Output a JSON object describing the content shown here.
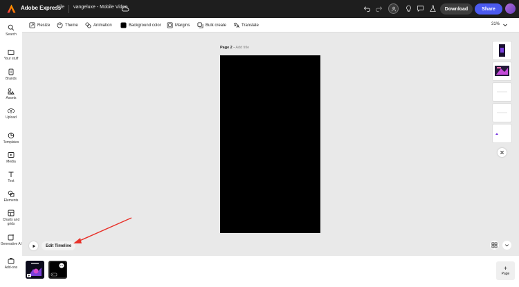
{
  "header": {
    "app_name": "Adobe Express",
    "file_menu": "File",
    "doc_title": "vangeluxe - Mobile Video",
    "download_label": "Download",
    "share_label": "Share"
  },
  "sidebar": {
    "items": [
      {
        "label": "Search",
        "icon": "search-icon"
      },
      {
        "label": "Your stuff",
        "icon": "folder-icon"
      },
      {
        "label": "Brands",
        "icon": "brand-icon"
      },
      {
        "label": "Assets",
        "icon": "assets-icon"
      },
      {
        "label": "Upload",
        "icon": "upload-icon"
      },
      {
        "label": "Templates",
        "icon": "templates-icon"
      },
      {
        "label": "Media",
        "icon": "media-icon"
      },
      {
        "label": "Text",
        "icon": "text-icon"
      },
      {
        "label": "Elements",
        "icon": "elements-icon"
      },
      {
        "label": "Charts and grids",
        "icon": "charts-icon"
      },
      {
        "label": "Generative AI",
        "icon": "generative-ai-icon"
      },
      {
        "label": "Add-ons",
        "icon": "add-ons-icon"
      }
    ]
  },
  "toolbar": {
    "resize": "Resize",
    "theme": "Theme",
    "animation": "Animation",
    "background_color": "Background color",
    "margins": "Margins",
    "bulk_create": "Bulk create",
    "translate": "Translate",
    "zoom": "31%"
  },
  "canvas": {
    "page_label": "Page 2",
    "separator": " - ",
    "add_title": "Add title",
    "artboard_color": "#000000"
  },
  "timeline": {
    "edit_label": "Edit Timeline"
  },
  "bottom": {
    "add_page_label": "Page"
  },
  "colors": {
    "accent": "#4b5af0",
    "topbar": "#1e1e1e",
    "annotation": "#e8322a"
  }
}
